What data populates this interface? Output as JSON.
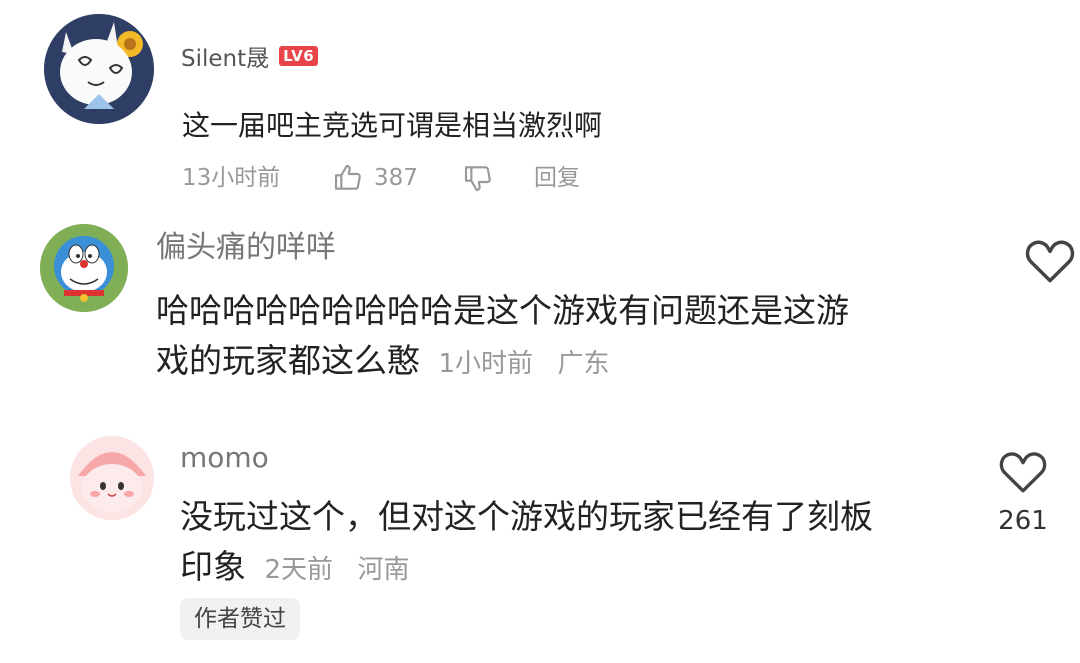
{
  "comments": [
    {
      "user": "Silent晟",
      "level_badge": "LV6",
      "text": "这一届吧主竞选可谓是相当激烈啊",
      "time": "13小时前",
      "likes": "387",
      "reply_label": "回复"
    },
    {
      "user": "偏头痛的咩咩",
      "text": "哈哈哈哈哈哈哈哈哈是这个游戏有问题还是这游",
      "text_line2": "戏的玩家都这么憨",
      "time": "1小时前",
      "location": "广东"
    },
    {
      "user": "momo",
      "text": "没玩过这个，但对这个游戏的玩家已经有了刻板",
      "text_line2": "印象",
      "time": "2天前",
      "location": "河南",
      "likes": "261",
      "author_tag": "作者赞过"
    }
  ],
  "colors": {
    "badge": "#e8454a",
    "meta": "#999999",
    "name": "#777777"
  }
}
